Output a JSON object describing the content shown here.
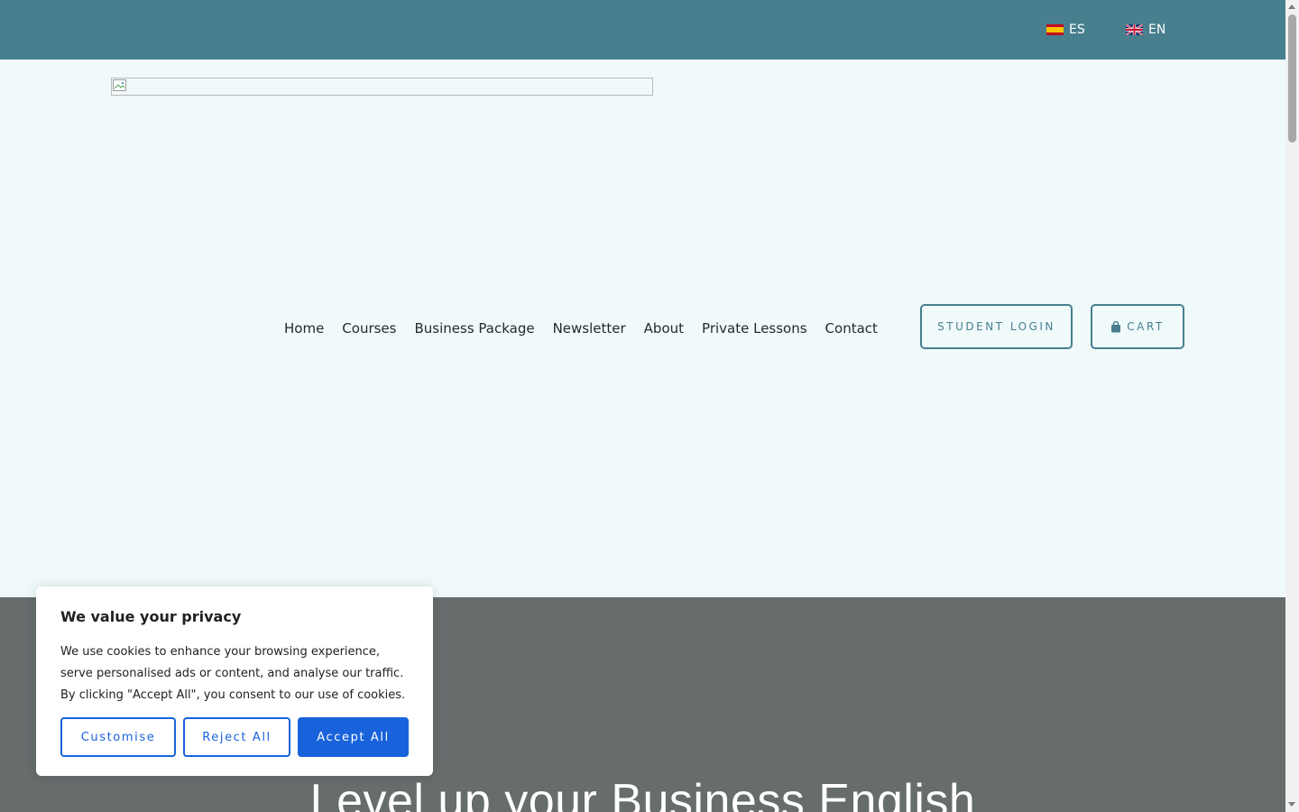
{
  "topbar": {
    "languages": [
      {
        "code": "ES",
        "flag_icon": "spain-flag-icon"
      },
      {
        "code": "EN",
        "flag_icon": "uk-flag-icon"
      }
    ]
  },
  "nav": {
    "items": [
      "Home",
      "Courses",
      "Business Package",
      "Newsletter",
      "About",
      "Private Lessons",
      "Contact"
    ],
    "student_login": "STUDENT LOGIN",
    "cart": "CART",
    "cart_icon": "shopping-bag-icon"
  },
  "hero": {
    "title": "Level up your Business English"
  },
  "cookie": {
    "title": "We value your privacy",
    "body": "We use cookies to enhance your browsing experience, serve personalised ads or content, and analyse our traffic. By clicking \"Accept All\", you consent to our use of cookies.",
    "customise": "Customise",
    "reject": "Reject All",
    "accept": "Accept All"
  },
  "colors": {
    "topbar": "#477f8e",
    "header_bg": "#f0fafb",
    "hero_bg": "#676c6d",
    "cookie_accent": "#1863dc"
  }
}
